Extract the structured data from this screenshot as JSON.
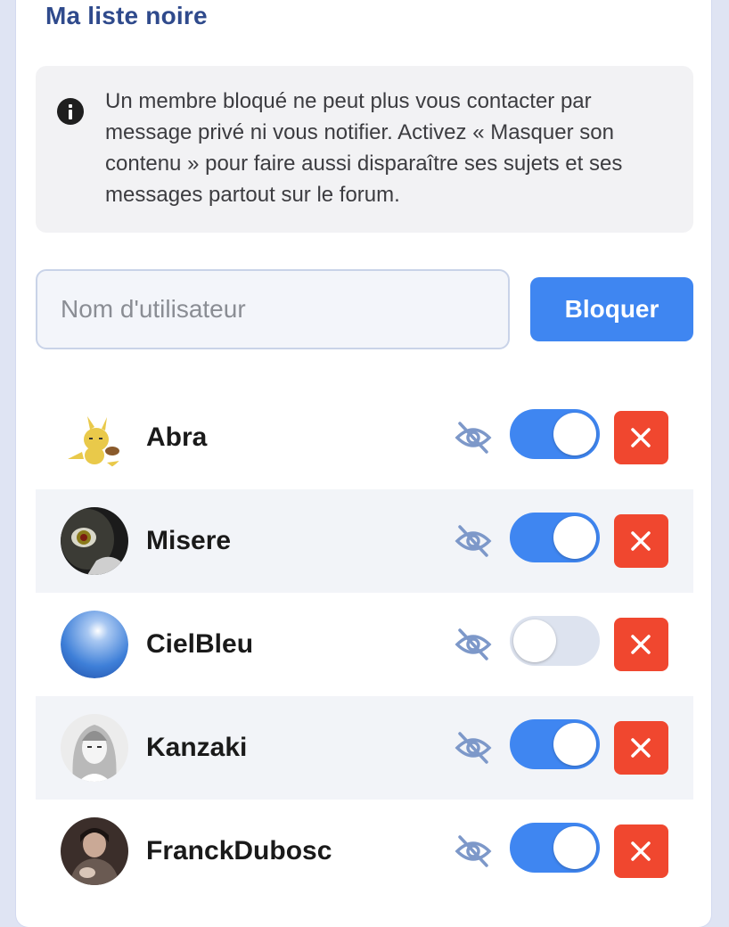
{
  "header": {
    "title": "Ma liste noire"
  },
  "info": {
    "icon": "info-circle-icon",
    "text": "Un membre bloqué ne peut plus vous contacter par message privé ni vous notifier. Activez « Masquer son contenu » pour faire aussi disparaître ses sujets et ses messages partout sur le forum."
  },
  "form": {
    "input_placeholder": "Nom d'utilisateur",
    "input_value": "",
    "button_label": "Bloquer"
  },
  "colors": {
    "accent": "#3f86f1",
    "danger": "#f0472f",
    "title": "#2f4a8c",
    "toggle_off": "#dde3ef"
  },
  "blocked_users": [
    {
      "name": "Abra",
      "avatar": "abra-pokemon-avatar",
      "hide_content": true
    },
    {
      "name": "Misere",
      "avatar": "dark-eye-avatar",
      "hide_content": true
    },
    {
      "name": "CielBleu",
      "avatar": "blue-sphere-avatar",
      "hide_content": false
    },
    {
      "name": "Kanzaki",
      "avatar": "manga-girl-avatar",
      "hide_content": true
    },
    {
      "name": "FranckDubosc",
      "avatar": "photo-person-avatar",
      "hide_content": true
    }
  ],
  "row_icons": {
    "hide": "eye-slash-icon",
    "remove": "close-icon"
  }
}
